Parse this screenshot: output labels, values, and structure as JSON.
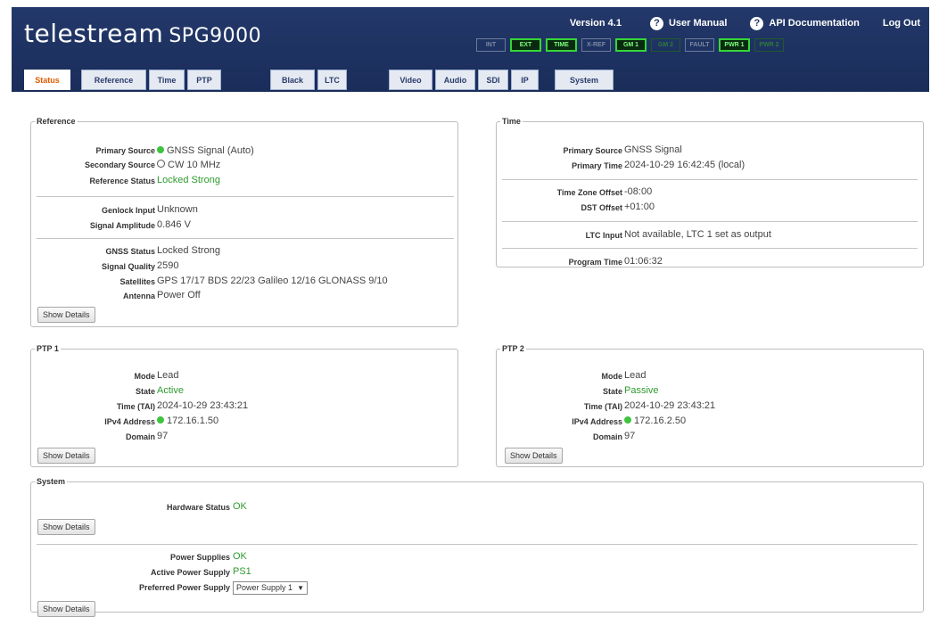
{
  "header": {
    "brand": "telestream",
    "model": "SPG9000",
    "version": "Version 4.1",
    "user_manual": "User Manual",
    "api_docs": "API Documentation",
    "logout": "Log Out",
    "accent_bg": "#23386a"
  },
  "leds": [
    {
      "label": "INT",
      "state": "off"
    },
    {
      "label": "EXT",
      "state": "on"
    },
    {
      "label": "TIME",
      "state": "on"
    },
    {
      "label": "X-REF",
      "state": "off"
    },
    {
      "label": "GM 1",
      "state": "on"
    },
    {
      "label": "GM 2",
      "state": "dim"
    },
    {
      "label": "FAULT",
      "state": "off"
    },
    {
      "label": "PWR 1",
      "state": "on"
    },
    {
      "label": "PWR 2",
      "state": "dim"
    }
  ],
  "tabs": [
    "Status",
    "Reference",
    "Time",
    "PTP",
    "Black",
    "LTC",
    "Video",
    "Audio",
    "SDI",
    "IP",
    "System"
  ],
  "active_tab": "Status",
  "reference": {
    "legend": "Reference",
    "primary_source_label": "Primary Source",
    "primary_source": "GNSS Signal (Auto)",
    "secondary_source_label": "Secondary Source",
    "secondary_source": "CW 10 MHz",
    "reference_status_label": "Reference Status",
    "reference_status": "Locked Strong",
    "genlock_input_label": "Genlock Input",
    "genlock_input": "Unknown",
    "signal_amplitude_label": "Signal Amplitude",
    "signal_amplitude": "0.846 V",
    "gnss_status_label": "GNSS Status",
    "gnss_status": "Locked Strong",
    "signal_quality_label": "Signal Quality",
    "signal_quality": "2590",
    "satellites_label": "Satellites",
    "satellites": "GPS 17/17 BDS 22/23 Galileo 12/16 GLONASS 9/10",
    "antenna_label": "Antenna",
    "antenna": "Power Off",
    "show_details": "Show Details"
  },
  "time": {
    "legend": "Time",
    "primary_source_label": "Primary Source",
    "primary_source": "GNSS Signal",
    "primary_time_label": "Primary Time",
    "primary_time": "2024-10-29 16:42:45 (local)",
    "tz_offset_label": "Time Zone Offset",
    "tz_offset": "-08:00",
    "dst_offset_label": "DST Offset",
    "dst_offset": "+01:00",
    "ltc_input_label": "LTC Input",
    "ltc_input": "Not available, LTC 1 set as output",
    "program_time_label": "Program Time",
    "program_time": "01:06:32"
  },
  "ptp1": {
    "legend": "PTP 1",
    "mode_label": "Mode",
    "mode": "Lead",
    "state_label": "State",
    "state": "Active",
    "time_label": "Time (TAI)",
    "time": "2024-10-29 23:43:21",
    "ipv4_label": "IPv4 Address",
    "ipv4": "172.16.1.50",
    "domain_label": "Domain",
    "domain": "97",
    "show_details": "Show Details"
  },
  "ptp2": {
    "legend": "PTP 2",
    "mode_label": "Mode",
    "mode": "Lead",
    "state_label": "State",
    "state": "Passive",
    "time_label": "Time (TAI)",
    "time": "2024-10-29 23:43:21",
    "ipv4_label": "IPv4 Address",
    "ipv4": "172.16.2.50",
    "domain_label": "Domain",
    "domain": "97",
    "show_details": "Show Details"
  },
  "system": {
    "legend": "System",
    "hardware_status_label": "Hardware Status",
    "hardware_status": "OK",
    "show_details_1": "Show Details",
    "power_supplies_label": "Power Supplies",
    "power_supplies": "OK",
    "active_ps_label": "Active Power Supply",
    "active_ps": "PS1",
    "preferred_ps_label": "Preferred Power Supply",
    "preferred_ps": "Power Supply 1",
    "show_details_2": "Show Details"
  },
  "colors": {
    "ok_green": "#2e9b2e",
    "led_green": "#36d636",
    "active_tab": "#e05a00"
  }
}
